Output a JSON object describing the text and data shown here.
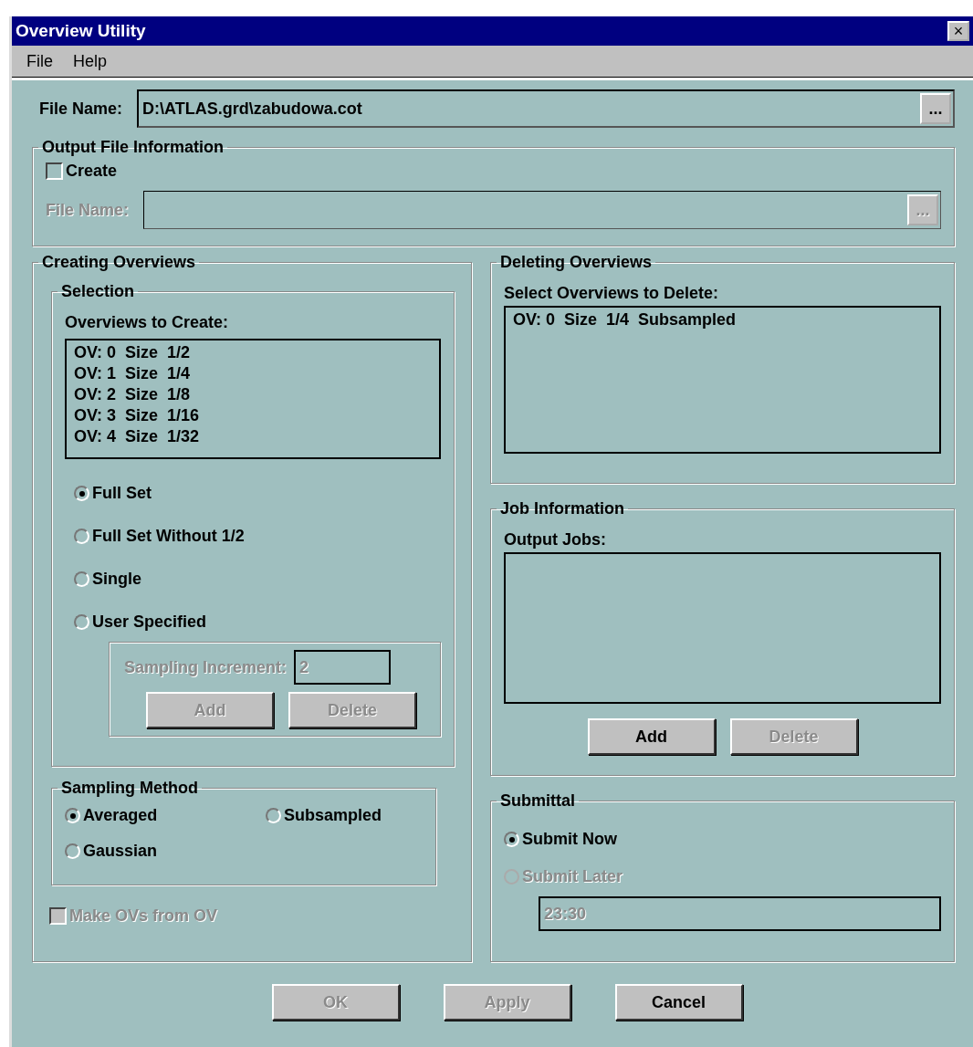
{
  "window": {
    "title": "Overview Utility",
    "close": "×"
  },
  "menu": [
    {
      "label": "File"
    },
    {
      "label": "Help"
    }
  ],
  "file_name": {
    "label": "File Name:",
    "value": "D:\\ATLAS.grd\\zabudowa.cot",
    "browse": "...",
    "disabled": false
  },
  "output_file_information": {
    "title": "Output File Information",
    "create": {
      "label": "Create",
      "checked": false,
      "disabled": false
    },
    "file_name": {
      "label": "File Name:",
      "browse": "...",
      "disabled": true
    }
  },
  "creating_overviews": {
    "title": "Creating Overviews",
    "selection": {
      "title": "Selection",
      "list_label": "Overviews to Create:",
      "items": [
        "OV: 0  Size  1/2",
        "OV: 1  Size  1/4",
        "OV: 2  Size  1/8",
        "OV: 3  Size  1/16",
        "OV: 4  Size  1/32"
      ],
      "options": [
        {
          "label": "Full Set",
          "selected": true,
          "disabled": false
        },
        {
          "label": "Full Set Without 1/2",
          "selected": false,
          "disabled": false
        },
        {
          "label": "Single",
          "selected": false,
          "disabled": false
        },
        {
          "label": "User Specified",
          "selected": false,
          "disabled": false
        }
      ],
      "sampling_increment": {
        "label": "Sampling Increment:",
        "value": "2",
        "disabled": true
      },
      "buttons": [
        {
          "label": "Add",
          "disabled": true
        },
        {
          "label": "Delete",
          "disabled": true
        }
      ]
    },
    "sampling_method": {
      "title": "Sampling Method",
      "options": [
        {
          "label": "Averaged",
          "selected": true,
          "disabled": false
        },
        {
          "label": "Subsampled",
          "selected": false,
          "disabled": false
        },
        {
          "label": "Gaussian",
          "selected": false,
          "disabled": false
        }
      ]
    },
    "make_ovs": {
      "label": "Make OVs from OV",
      "checked": false,
      "disabled": true
    }
  },
  "deleting_overviews": {
    "title": "Deleting Overviews",
    "list_label": "Select Overviews to Delete:",
    "items": [
      "OV: 0  Size  1/4  Subsampled"
    ]
  },
  "job_information": {
    "title": "Job Information",
    "list_label": "Output Jobs:",
    "buttons": [
      {
        "label": "Add",
        "disabled": false
      },
      {
        "label": "Delete",
        "disabled": true
      }
    ]
  },
  "submittal": {
    "title": "Submittal",
    "options": [
      {
        "label": "Submit Now",
        "selected": true,
        "disabled": false
      },
      {
        "label": "Submit Later",
        "selected": false,
        "disabled": true
      }
    ],
    "time": {
      "value": "23:30",
      "disabled": true
    }
  },
  "buttons": [
    {
      "label": "OK",
      "disabled": true
    },
    {
      "label": "Apply",
      "disabled": true
    },
    {
      "label": "Cancel",
      "disabled": false
    }
  ]
}
